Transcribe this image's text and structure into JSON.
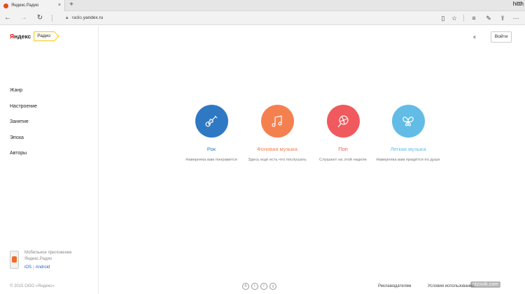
{
  "browser": {
    "tab_title": "Яндекс.Радио",
    "tab_close": "×",
    "new_tab": "+",
    "corner_text": "hitth",
    "url_prefix": "radio.",
    "url_host": "yandex.ru"
  },
  "header": {
    "logo_yandex_first": "Я",
    "logo_yandex_rest": "ндекс",
    "logo_radio": "Радио",
    "login_label": "Войти"
  },
  "sidebar": {
    "menu": [
      {
        "label": "Жанр"
      },
      {
        "label": "Настроение"
      },
      {
        "label": "Занятие"
      },
      {
        "label": "Эпоха"
      },
      {
        "label": "Авторы"
      }
    ],
    "promo": {
      "text": "Мобильное приложение Яндекс.Радио",
      "ios": "iOS",
      "android": "Android"
    },
    "copyright": "© 2015 ООО «Яндекс»"
  },
  "genres": [
    {
      "name": "Рок",
      "desc": "Наверняка вам понравится",
      "color": "#2f79c4",
      "icon": "guitar-icon"
    },
    {
      "name": "Фоновая музыка",
      "desc": "Здесь ещё есть что послушать",
      "color": "#f5804f",
      "icon": "music-note-icon"
    },
    {
      "name": "Поп",
      "desc": "Слушают на этой неделе",
      "color": "#f05a5e",
      "icon": "lollipop-icon"
    },
    {
      "name": "Легкая музыка",
      "desc": "Наверняка вам придётся по душе",
      "color": "#62bce6",
      "icon": "butterfly-icon"
    }
  ],
  "footer": {
    "socials": [
      "В",
      "t",
      "f",
      "g"
    ],
    "advertisers": "Рекламодателям",
    "terms": "Условия использования"
  },
  "watermark": "otzovik.com"
}
